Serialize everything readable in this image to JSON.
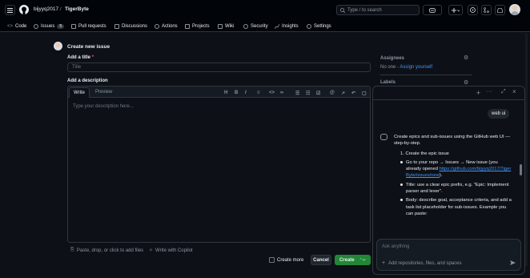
{
  "header": {
    "owner": "bijyyq2017",
    "separator": "/",
    "repo": "TigerByte",
    "search_placeholder": "Type / to search"
  },
  "tabs": [
    {
      "label": "Code"
    },
    {
      "label": "Issues",
      "count": "5"
    },
    {
      "label": "Pull requests"
    },
    {
      "label": "Discussions"
    },
    {
      "label": "Actions"
    },
    {
      "label": "Projects"
    },
    {
      "label": "Wiki"
    },
    {
      "label": "Security"
    },
    {
      "label": "Insights"
    },
    {
      "label": "Settings"
    }
  ],
  "form": {
    "heading": "Create new issue",
    "title_label": "Add a title",
    "required_mark": "*",
    "title_placeholder": "Title",
    "desc_label": "Add a description",
    "write_tab": "Write",
    "preview_tab": "Preview",
    "desc_placeholder": "Type your description here...",
    "paste_hint": "Paste, drop, or click to add files",
    "copilot_hint": "Write with Copilot",
    "create_more": "Create more",
    "cancel": "Cancel",
    "create": "Create",
    "create_shortcut": "⌃↵"
  },
  "sidebar": {
    "assignees_label": "Assignees",
    "assignees_none": "No one -",
    "assign_yourself": "Assign yourself",
    "labels_label": "Labels"
  },
  "chat": {
    "user_message": "web ui",
    "intro": "Create epics and sub-issues using the GitHub web UI — step-by-step.",
    "step1": "1. Create the epic issue",
    "b1_text": "Go to your repo → Issues → New issue (you already opened",
    "b1_link": "https://github.com/bijyyq2017/TigerByte/issues/new",
    "b1_end": ").",
    "b2": "Title: use a clear epic prefix, e.g. \"Epic: Implement parser and lexer\".",
    "b3": "Body: describe goal, acceptance criteria, and add a task list placeholder for sub-issues. Example you can paste:",
    "input_placeholder": "Ask anything",
    "add_context": "Add repositories, files, and spaces"
  },
  "colors": {
    "create_button": "#238636",
    "link": "#4493f8",
    "issues_count_badge": "#30363d"
  }
}
